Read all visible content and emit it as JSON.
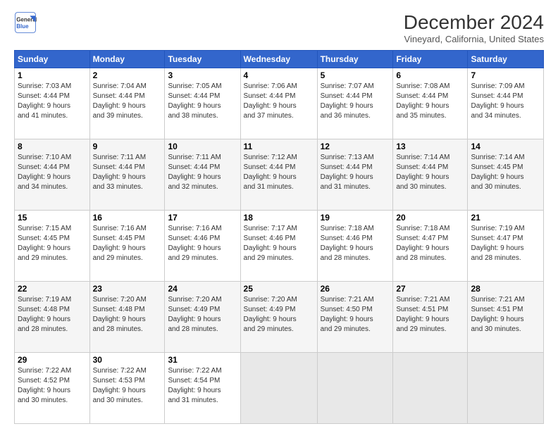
{
  "logo": {
    "line1": "General",
    "line2": "Blue"
  },
  "title": "December 2024",
  "location": "Vineyard, California, United States",
  "days_header": [
    "Sunday",
    "Monday",
    "Tuesday",
    "Wednesday",
    "Thursday",
    "Friday",
    "Saturday"
  ],
  "weeks": [
    [
      {
        "day": "1",
        "info": "Sunrise: 7:03 AM\nSunset: 4:44 PM\nDaylight: 9 hours\nand 41 minutes."
      },
      {
        "day": "2",
        "info": "Sunrise: 7:04 AM\nSunset: 4:44 PM\nDaylight: 9 hours\nand 39 minutes."
      },
      {
        "day": "3",
        "info": "Sunrise: 7:05 AM\nSunset: 4:44 PM\nDaylight: 9 hours\nand 38 minutes."
      },
      {
        "day": "4",
        "info": "Sunrise: 7:06 AM\nSunset: 4:44 PM\nDaylight: 9 hours\nand 37 minutes."
      },
      {
        "day": "5",
        "info": "Sunrise: 7:07 AM\nSunset: 4:44 PM\nDaylight: 9 hours\nand 36 minutes."
      },
      {
        "day": "6",
        "info": "Sunrise: 7:08 AM\nSunset: 4:44 PM\nDaylight: 9 hours\nand 35 minutes."
      },
      {
        "day": "7",
        "info": "Sunrise: 7:09 AM\nSunset: 4:44 PM\nDaylight: 9 hours\nand 34 minutes."
      }
    ],
    [
      {
        "day": "8",
        "info": "Sunrise: 7:10 AM\nSunset: 4:44 PM\nDaylight: 9 hours\nand 34 minutes."
      },
      {
        "day": "9",
        "info": "Sunrise: 7:11 AM\nSunset: 4:44 PM\nDaylight: 9 hours\nand 33 minutes."
      },
      {
        "day": "10",
        "info": "Sunrise: 7:11 AM\nSunset: 4:44 PM\nDaylight: 9 hours\nand 32 minutes."
      },
      {
        "day": "11",
        "info": "Sunrise: 7:12 AM\nSunset: 4:44 PM\nDaylight: 9 hours\nand 31 minutes."
      },
      {
        "day": "12",
        "info": "Sunrise: 7:13 AM\nSunset: 4:44 PM\nDaylight: 9 hours\nand 31 minutes."
      },
      {
        "day": "13",
        "info": "Sunrise: 7:14 AM\nSunset: 4:44 PM\nDaylight: 9 hours\nand 30 minutes."
      },
      {
        "day": "14",
        "info": "Sunrise: 7:14 AM\nSunset: 4:45 PM\nDaylight: 9 hours\nand 30 minutes."
      }
    ],
    [
      {
        "day": "15",
        "info": "Sunrise: 7:15 AM\nSunset: 4:45 PM\nDaylight: 9 hours\nand 29 minutes."
      },
      {
        "day": "16",
        "info": "Sunrise: 7:16 AM\nSunset: 4:45 PM\nDaylight: 9 hours\nand 29 minutes."
      },
      {
        "day": "17",
        "info": "Sunrise: 7:16 AM\nSunset: 4:46 PM\nDaylight: 9 hours\nand 29 minutes."
      },
      {
        "day": "18",
        "info": "Sunrise: 7:17 AM\nSunset: 4:46 PM\nDaylight: 9 hours\nand 29 minutes."
      },
      {
        "day": "19",
        "info": "Sunrise: 7:18 AM\nSunset: 4:46 PM\nDaylight: 9 hours\nand 28 minutes."
      },
      {
        "day": "20",
        "info": "Sunrise: 7:18 AM\nSunset: 4:47 PM\nDaylight: 9 hours\nand 28 minutes."
      },
      {
        "day": "21",
        "info": "Sunrise: 7:19 AM\nSunset: 4:47 PM\nDaylight: 9 hours\nand 28 minutes."
      }
    ],
    [
      {
        "day": "22",
        "info": "Sunrise: 7:19 AM\nSunset: 4:48 PM\nDaylight: 9 hours\nand 28 minutes."
      },
      {
        "day": "23",
        "info": "Sunrise: 7:20 AM\nSunset: 4:48 PM\nDaylight: 9 hours\nand 28 minutes."
      },
      {
        "day": "24",
        "info": "Sunrise: 7:20 AM\nSunset: 4:49 PM\nDaylight: 9 hours\nand 28 minutes."
      },
      {
        "day": "25",
        "info": "Sunrise: 7:20 AM\nSunset: 4:49 PM\nDaylight: 9 hours\nand 29 minutes."
      },
      {
        "day": "26",
        "info": "Sunrise: 7:21 AM\nSunset: 4:50 PM\nDaylight: 9 hours\nand 29 minutes."
      },
      {
        "day": "27",
        "info": "Sunrise: 7:21 AM\nSunset: 4:51 PM\nDaylight: 9 hours\nand 29 minutes."
      },
      {
        "day": "28",
        "info": "Sunrise: 7:21 AM\nSunset: 4:51 PM\nDaylight: 9 hours\nand 30 minutes."
      }
    ],
    [
      {
        "day": "29",
        "info": "Sunrise: 7:22 AM\nSunset: 4:52 PM\nDaylight: 9 hours\nand 30 minutes."
      },
      {
        "day": "30",
        "info": "Sunrise: 7:22 AM\nSunset: 4:53 PM\nDaylight: 9 hours\nand 30 minutes."
      },
      {
        "day": "31",
        "info": "Sunrise: 7:22 AM\nSunset: 4:54 PM\nDaylight: 9 hours\nand 31 minutes."
      },
      {
        "day": "",
        "info": ""
      },
      {
        "day": "",
        "info": ""
      },
      {
        "day": "",
        "info": ""
      },
      {
        "day": "",
        "info": ""
      }
    ]
  ]
}
